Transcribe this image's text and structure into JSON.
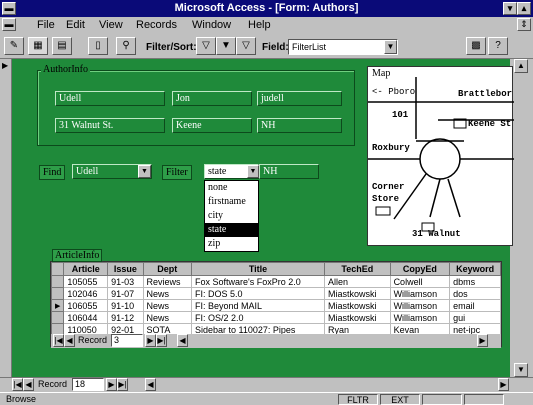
{
  "title": "Microsoft Access - [Form: Authors]",
  "menu": [
    "File",
    "Edit",
    "View",
    "Records",
    "Window",
    "Help"
  ],
  "toolbar": {
    "filter_sort_label": "Filter/Sort:",
    "field_label": "Field:",
    "field_value": "FilterList"
  },
  "author_info": {
    "label": "AuthorInfo",
    "last_name": "Udell",
    "first_name": "Jon",
    "login": "judell",
    "address": "31 Walnut St.",
    "city": "Keene",
    "state": "NH"
  },
  "map": {
    "label": "Map",
    "place_left": "<- Pboro",
    "place_right": "Brattlebor",
    "road": "101",
    "street": "Keene St",
    "town": "Roxbury",
    "store": "Corner\nStore",
    "dest": "31 Walnut"
  },
  "find": {
    "label": "Find",
    "value": "Udell"
  },
  "filter": {
    "label": "Filter",
    "value": "state",
    "text": "NH",
    "options": [
      "none",
      "firstname",
      "city",
      "state",
      "zip"
    ],
    "selected_index": 3
  },
  "article_info": {
    "label": "ArticleInfo",
    "columns": [
      "Article",
      "Issue",
      "Dept",
      "Title",
      "TechEd",
      "CopyEd",
      "Keyword"
    ],
    "rows": [
      [
        "105055",
        "91-03",
        "Reviews",
        "Fox Software's FoxPro 2.0",
        "Allen",
        "Colwell",
        "dbms"
      ],
      [
        "102046",
        "91-07",
        "News",
        "FI: DOS 5.0",
        "Miastkowski",
        "Williamson",
        "dos"
      ],
      [
        "106055",
        "91-10",
        "News",
        "FI: Beyond MAIL",
        "Miastkowski",
        "Williamson",
        "email"
      ],
      [
        "106044",
        "91-12",
        "News",
        "FI: OS/2 2.0",
        "Miastkowski",
        "Williamson",
        "gui"
      ],
      [
        "110050",
        "92-01",
        "SOTA",
        "Sidebar to 110027: Pipes",
        "Ryan",
        "Kevan",
        "net-ipc"
      ]
    ],
    "current_row_index": 2,
    "record_label": "Record",
    "record_number": "3"
  },
  "main_nav": {
    "record_label": "Record",
    "record_number": "18"
  },
  "status": {
    "mode": "Browse",
    "flags": [
      "FLTR",
      "EXT"
    ]
  }
}
